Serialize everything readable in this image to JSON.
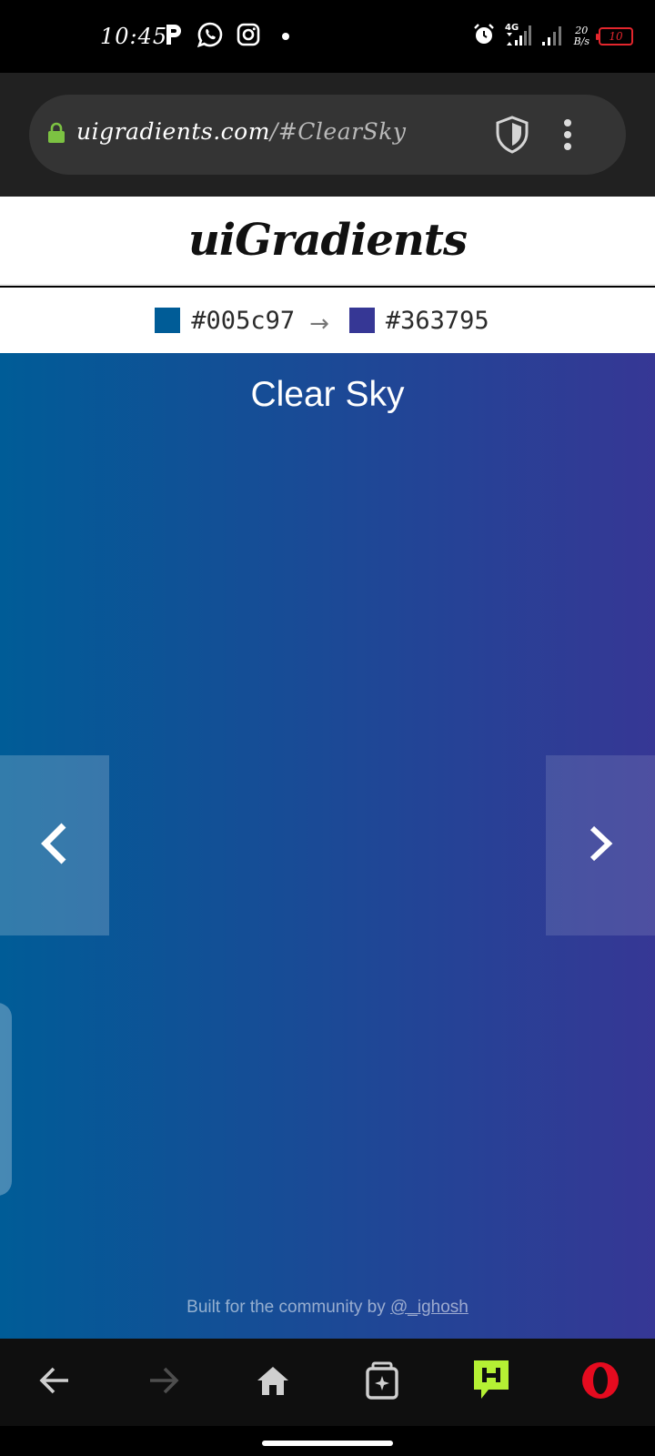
{
  "status_bar": {
    "time": "10:45",
    "network": "4G",
    "net_rate_top": "20",
    "net_rate_bottom": "B/s",
    "battery": "10",
    "left_icons": [
      "parking-icon",
      "whatsapp-icon",
      "instagram-icon",
      "dot-icon"
    ],
    "right_icons": [
      "alarm-icon",
      "signal-4g-icon",
      "signal-icon"
    ],
    "battery_color": "#e3262d"
  },
  "browser": {
    "url_host": "uigradients.com",
    "url_path": "/#ClearSky",
    "lock_color": "#7cc242"
  },
  "site": {
    "logo": "uiGradients",
    "color_from": "#005c97",
    "color_arrow": "→",
    "color_to": "#363795",
    "gradient_name": "Clear Sky",
    "footer_prefix": "Built for the community by ",
    "footer_link": "@_ighosh"
  },
  "toolbar": {
    "items": [
      "back-icon",
      "forward-icon",
      "home-icon",
      "tabs-icon",
      "hype-icon",
      "opera-icon"
    ],
    "hype_color": "#b5f034",
    "opera_color": "#e50b1f"
  }
}
